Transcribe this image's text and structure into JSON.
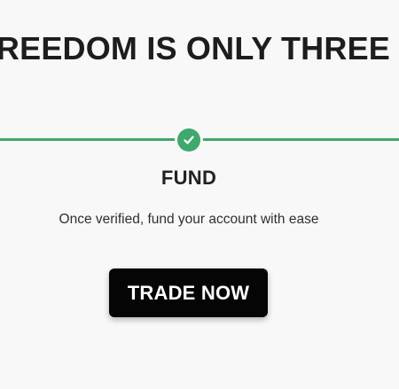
{
  "hero": {
    "headline": "FINANCIAL FREEDOM IS ONLY THREE STEPS AWAY"
  },
  "step": {
    "title": "FUND",
    "description": "Once verified, fund your account with ease",
    "status_icon": "check-icon",
    "status": "completed"
  },
  "cta": {
    "label": "TRADE NOW"
  },
  "colors": {
    "background": "#f8f8f8",
    "accent_green": "#3fa86b",
    "button_bg": "#050505",
    "button_text": "#ffffff",
    "heading_text": "#1d1d1d"
  }
}
